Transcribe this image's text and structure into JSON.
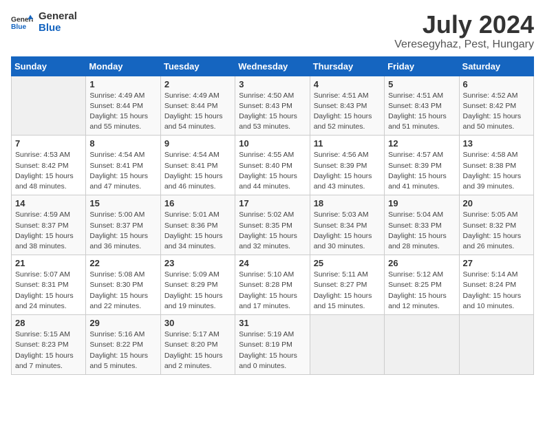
{
  "logo": {
    "text_general": "General",
    "text_blue": "Blue"
  },
  "title": "July 2024",
  "subtitle": "Veresegyhaz, Pest, Hungary",
  "days_of_week": [
    "Sunday",
    "Monday",
    "Tuesday",
    "Wednesday",
    "Thursday",
    "Friday",
    "Saturday"
  ],
  "weeks": [
    [
      {
        "day": "",
        "info": ""
      },
      {
        "day": "1",
        "info": "Sunrise: 4:49 AM\nSunset: 8:44 PM\nDaylight: 15 hours\nand 55 minutes."
      },
      {
        "day": "2",
        "info": "Sunrise: 4:49 AM\nSunset: 8:44 PM\nDaylight: 15 hours\nand 54 minutes."
      },
      {
        "day": "3",
        "info": "Sunrise: 4:50 AM\nSunset: 8:43 PM\nDaylight: 15 hours\nand 53 minutes."
      },
      {
        "day": "4",
        "info": "Sunrise: 4:51 AM\nSunset: 8:43 PM\nDaylight: 15 hours\nand 52 minutes."
      },
      {
        "day": "5",
        "info": "Sunrise: 4:51 AM\nSunset: 8:43 PM\nDaylight: 15 hours\nand 51 minutes."
      },
      {
        "day": "6",
        "info": "Sunrise: 4:52 AM\nSunset: 8:42 PM\nDaylight: 15 hours\nand 50 minutes."
      }
    ],
    [
      {
        "day": "7",
        "info": "Sunrise: 4:53 AM\nSunset: 8:42 PM\nDaylight: 15 hours\nand 48 minutes."
      },
      {
        "day": "8",
        "info": "Sunrise: 4:54 AM\nSunset: 8:41 PM\nDaylight: 15 hours\nand 47 minutes."
      },
      {
        "day": "9",
        "info": "Sunrise: 4:54 AM\nSunset: 8:41 PM\nDaylight: 15 hours\nand 46 minutes."
      },
      {
        "day": "10",
        "info": "Sunrise: 4:55 AM\nSunset: 8:40 PM\nDaylight: 15 hours\nand 44 minutes."
      },
      {
        "day": "11",
        "info": "Sunrise: 4:56 AM\nSunset: 8:39 PM\nDaylight: 15 hours\nand 43 minutes."
      },
      {
        "day": "12",
        "info": "Sunrise: 4:57 AM\nSunset: 8:39 PM\nDaylight: 15 hours\nand 41 minutes."
      },
      {
        "day": "13",
        "info": "Sunrise: 4:58 AM\nSunset: 8:38 PM\nDaylight: 15 hours\nand 39 minutes."
      }
    ],
    [
      {
        "day": "14",
        "info": "Sunrise: 4:59 AM\nSunset: 8:37 PM\nDaylight: 15 hours\nand 38 minutes."
      },
      {
        "day": "15",
        "info": "Sunrise: 5:00 AM\nSunset: 8:37 PM\nDaylight: 15 hours\nand 36 minutes."
      },
      {
        "day": "16",
        "info": "Sunrise: 5:01 AM\nSunset: 8:36 PM\nDaylight: 15 hours\nand 34 minutes."
      },
      {
        "day": "17",
        "info": "Sunrise: 5:02 AM\nSunset: 8:35 PM\nDaylight: 15 hours\nand 32 minutes."
      },
      {
        "day": "18",
        "info": "Sunrise: 5:03 AM\nSunset: 8:34 PM\nDaylight: 15 hours\nand 30 minutes."
      },
      {
        "day": "19",
        "info": "Sunrise: 5:04 AM\nSunset: 8:33 PM\nDaylight: 15 hours\nand 28 minutes."
      },
      {
        "day": "20",
        "info": "Sunrise: 5:05 AM\nSunset: 8:32 PM\nDaylight: 15 hours\nand 26 minutes."
      }
    ],
    [
      {
        "day": "21",
        "info": "Sunrise: 5:07 AM\nSunset: 8:31 PM\nDaylight: 15 hours\nand 24 minutes."
      },
      {
        "day": "22",
        "info": "Sunrise: 5:08 AM\nSunset: 8:30 PM\nDaylight: 15 hours\nand 22 minutes."
      },
      {
        "day": "23",
        "info": "Sunrise: 5:09 AM\nSunset: 8:29 PM\nDaylight: 15 hours\nand 19 minutes."
      },
      {
        "day": "24",
        "info": "Sunrise: 5:10 AM\nSunset: 8:28 PM\nDaylight: 15 hours\nand 17 minutes."
      },
      {
        "day": "25",
        "info": "Sunrise: 5:11 AM\nSunset: 8:27 PM\nDaylight: 15 hours\nand 15 minutes."
      },
      {
        "day": "26",
        "info": "Sunrise: 5:12 AM\nSunset: 8:25 PM\nDaylight: 15 hours\nand 12 minutes."
      },
      {
        "day": "27",
        "info": "Sunrise: 5:14 AM\nSunset: 8:24 PM\nDaylight: 15 hours\nand 10 minutes."
      }
    ],
    [
      {
        "day": "28",
        "info": "Sunrise: 5:15 AM\nSunset: 8:23 PM\nDaylight: 15 hours\nand 7 minutes."
      },
      {
        "day": "29",
        "info": "Sunrise: 5:16 AM\nSunset: 8:22 PM\nDaylight: 15 hours\nand 5 minutes."
      },
      {
        "day": "30",
        "info": "Sunrise: 5:17 AM\nSunset: 8:20 PM\nDaylight: 15 hours\nand 2 minutes."
      },
      {
        "day": "31",
        "info": "Sunrise: 5:19 AM\nSunset: 8:19 PM\nDaylight: 15 hours\nand 0 minutes."
      },
      {
        "day": "",
        "info": ""
      },
      {
        "day": "",
        "info": ""
      },
      {
        "day": "",
        "info": ""
      }
    ]
  ]
}
